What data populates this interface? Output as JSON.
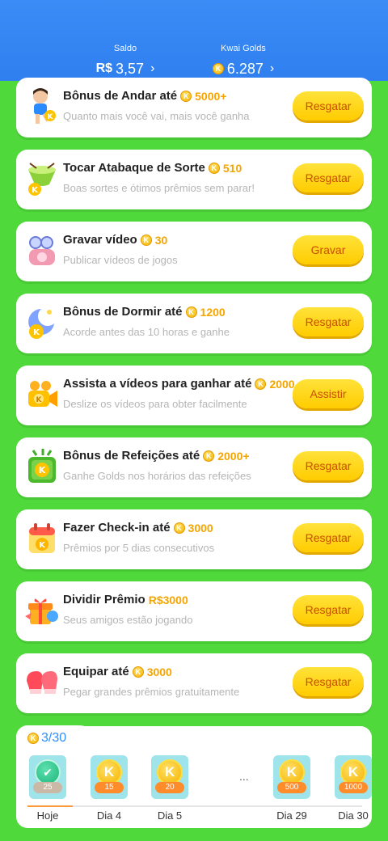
{
  "header": {
    "saldo_label": "Saldo",
    "saldo_currency": "R$",
    "saldo_value": "3,57",
    "golds_label": "Kwai Golds",
    "golds_value": "6.287"
  },
  "tasks": [
    {
      "title": "Bônus de Andar até",
      "amount": "5000+",
      "subtitle": "Quanto mais você vai, mais você ganha",
      "button": "Resgatar",
      "icon": "runner-icon"
    },
    {
      "title": "Tocar Atabaque de Sorte",
      "amount": "510",
      "subtitle": "Boas sortes e ótimos prêmios sem parar!",
      "button": "Resgatar",
      "icon": "drum-icon"
    },
    {
      "title": "Gravar vídeo",
      "amount": "30",
      "subtitle": "Publicar vídeos de jogos",
      "button": "Gravar",
      "icon": "camera-icon"
    },
    {
      "title": "Bônus de Dormir até",
      "amount": "1200",
      "subtitle": "Acorde antes das 10 horas e ganhe",
      "button": "Resgatar",
      "icon": "moon-icon"
    },
    {
      "title": "Assista a vídeos para ganhar até",
      "amount": "2000",
      "subtitle": "Deslize os vídeos para obter facilmente",
      "button": "Assistir",
      "icon": "video-camera-icon"
    },
    {
      "title": "Bônus de Refeições até",
      "amount": "2000+",
      "subtitle": "Ganhe Golds nos horários das refeições",
      "button": "Resgatar",
      "icon": "meal-icon"
    },
    {
      "title": "Fazer Check-in até",
      "amount": "3000",
      "subtitle": "Prêmios por 5 dias consecutivos",
      "button": "Resgatar",
      "icon": "calendar-icon"
    },
    {
      "title": "Dividir Prêmio",
      "amount": "R$3000",
      "subtitle": "Seus amigos estão jogando",
      "button": "Resgatar",
      "icon": "gift-icon"
    },
    {
      "title": "Equipar até",
      "amount": "3000",
      "subtitle": "Pegar grandes prêmios gratuitamente",
      "button": "Resgatar",
      "icon": "boxing-glove-icon"
    }
  ],
  "checkin": {
    "count": "3/30",
    "progress_fraction": 0.1,
    "days": [
      {
        "label": "Hoje",
        "value": "25",
        "today": true
      },
      {
        "label": "Dia 4",
        "value": "15"
      },
      {
        "label": "Dia 5",
        "value": "20"
      },
      {
        "label": "Dia 29",
        "value": "500"
      },
      {
        "label": "Dia 30",
        "value": "1000"
      }
    ],
    "ellipsis": "..."
  },
  "coin_letter": "K",
  "colors": {
    "accent": "#2f7ff0",
    "background": "#4fd93a",
    "button": "#ffd21a",
    "button_text": "#c94e00",
    "amount": "#f5a500"
  }
}
